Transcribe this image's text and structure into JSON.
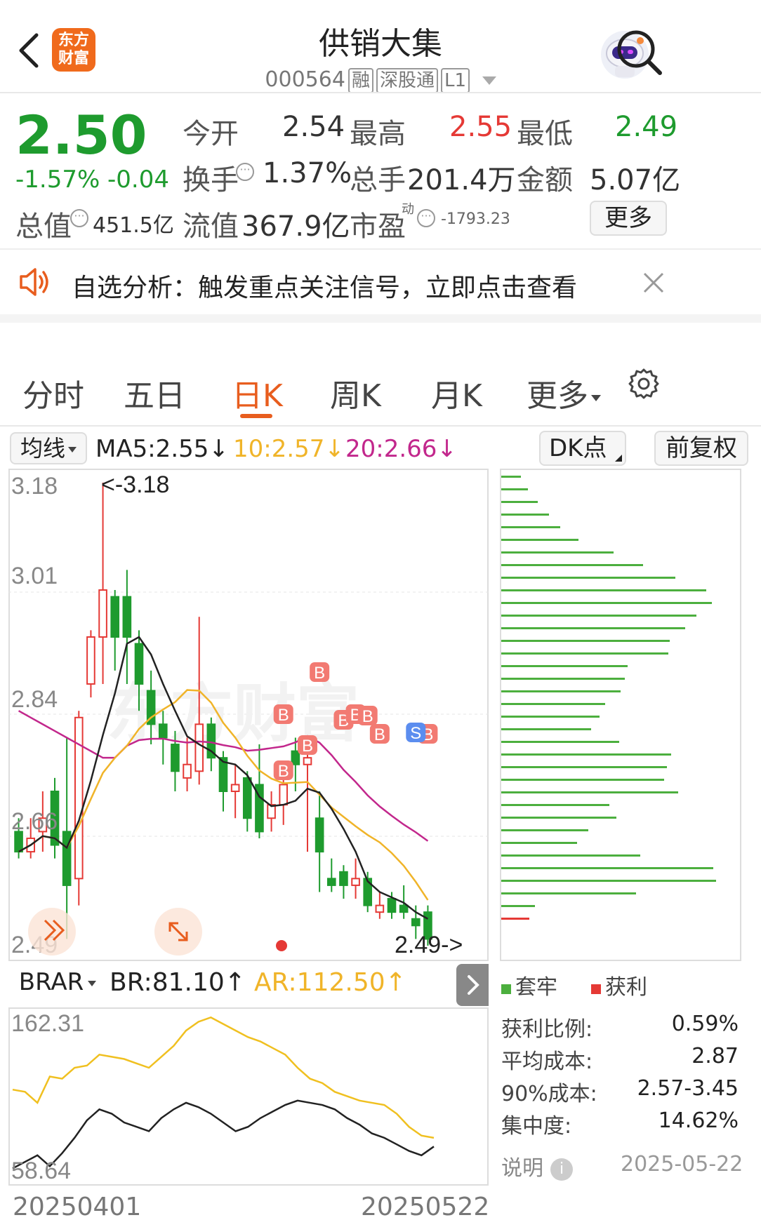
{
  "header": {
    "logo_text_1": "东方",
    "logo_text_2": "财富",
    "title": "供销大集",
    "code": "000564",
    "tags": [
      "融",
      "深股通",
      "L1"
    ]
  },
  "quote": {
    "price": "2.50",
    "change_pct": "-1.57%",
    "change": "-0.04",
    "open_label": "今开",
    "open": "2.54",
    "high_label": "最高",
    "high": "2.55",
    "low_label": "最低",
    "low": "2.49",
    "turnover_label": "换手",
    "turnover": "1.37%",
    "volume_label": "总手",
    "volume": "201.4万",
    "amount_label": "金额",
    "amount": "5.07亿",
    "mktcap_label": "总值",
    "mktcap": "451.5亿",
    "float_label": "流值",
    "float": "367.9亿",
    "pe_label": "市盈",
    "pe_sup": "动",
    "pe": "-1793.23",
    "more": "更多"
  },
  "notice": {
    "text": "自选分析：触发重点关注信号，立即点击查看"
  },
  "tabs": [
    "分时",
    "五日",
    "日K",
    "周K",
    "月K",
    "更多"
  ],
  "active_tab": "日K",
  "ma_bar": {
    "selector": "均线",
    "ma5": "MA5:2.55",
    "ma10": "10:2.57",
    "ma20": "20:2.66",
    "dk": "DK点",
    "fq": "前复权"
  },
  "kline": {
    "y_labels": [
      "3.18",
      "3.01",
      "2.84",
      "2.66",
      "2.49"
    ],
    "max_label": "<-3.18",
    "min_label": "2.49->",
    "watermark": "东方财富"
  },
  "indicator": {
    "selector": "BRAR",
    "br": "BR:81.10",
    "ar": "AR:112.50",
    "y_top": "162.31",
    "y_bottom": "58.64",
    "date_start": "20250401",
    "date_end": "20250522"
  },
  "chips": {
    "legend_loss": "套牢",
    "legend_profit": "获利",
    "rows": [
      {
        "label": "获利比例:",
        "value": "0.59%"
      },
      {
        "label": "平均成本:",
        "value": "2.87"
      },
      {
        "label": "90%成本:",
        "value": "2.57-3.45"
      },
      {
        "label": "集中度:",
        "value": "14.62%"
      }
    ],
    "note": "说明",
    "date": "2025-05-22"
  },
  "colors": {
    "up": "#e53935",
    "down": "#1e9b2e",
    "accent": "#e85d1e",
    "ma10": "#f0b429",
    "ma20": "#c2278c"
  }
}
